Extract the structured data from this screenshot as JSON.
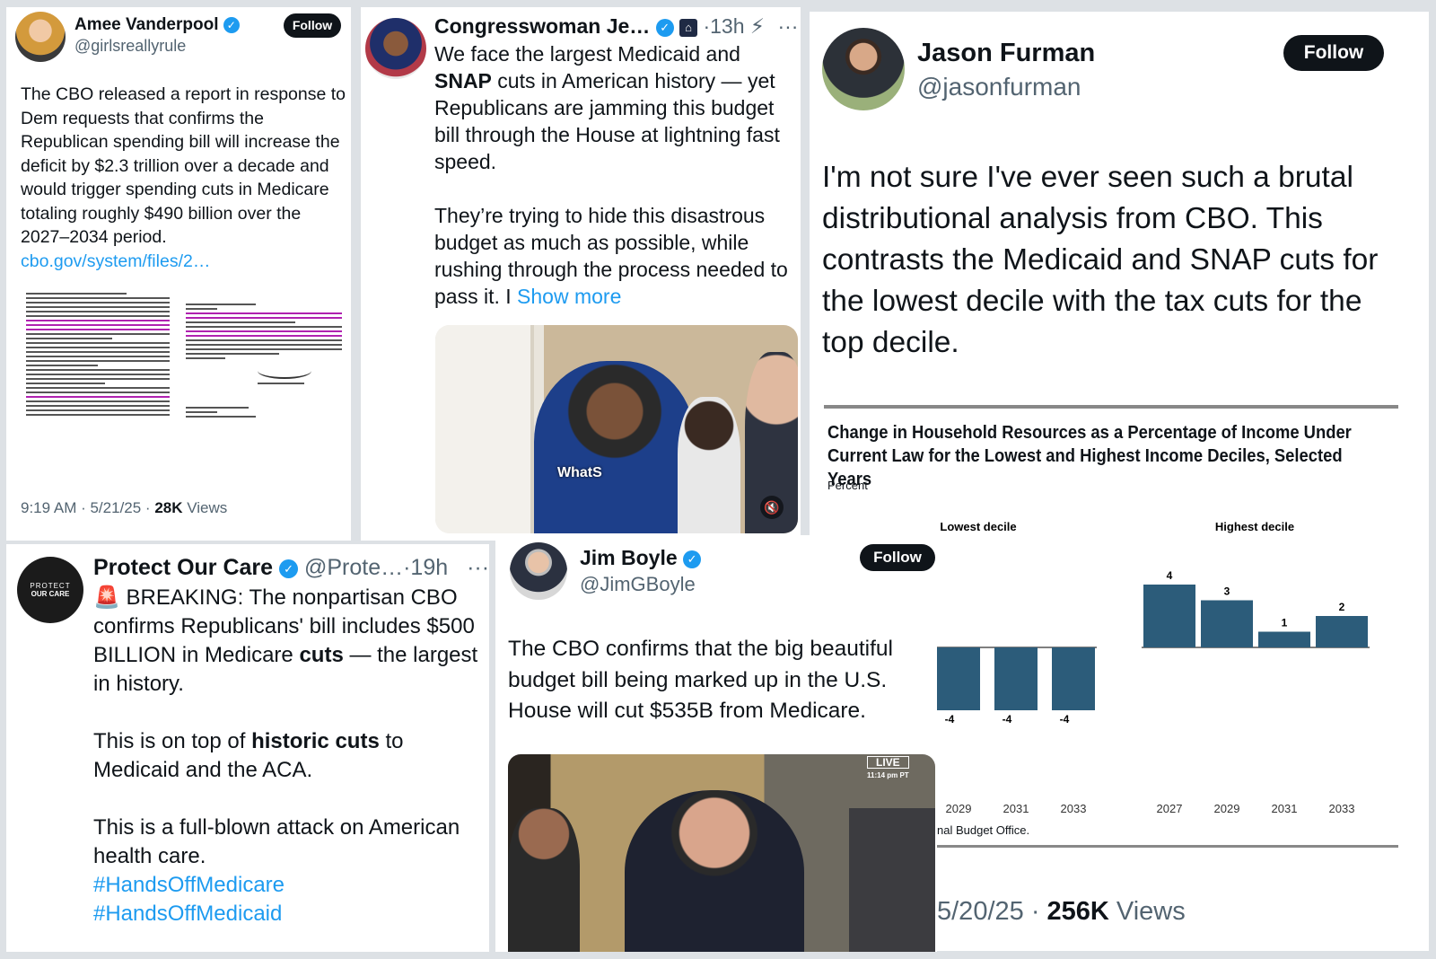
{
  "t1": {
    "name": "Amee Vanderpool",
    "handle": "@girlsreallyrule",
    "follow": "Follow",
    "text": "The CBO released a report in response to Dem requests that confirms the Republican spending bill will increase the deficit by $2.3 trillion over a decade and would trigger spending cuts in Medicare totaling roughly $490 billion over the 2027–2034 period.",
    "link": "cbo.gov/system/files/2…",
    "time": "9:19 AM · 5/21/25 · ",
    "views_count": "28K",
    "views_label": " Views",
    "icons": [
      "verified-badge"
    ]
  },
  "t2": {
    "name": "Congresswoman Je…",
    "time": "·13h",
    "more": "···",
    "text1": "We face the largest Medicaid and",
    "text1b": "SNAP",
    "text1c": " cuts in American history — yet Republicans are jamming this budget bill through the House at lightning fast speed.",
    "text2": "They’re trying to hide this disastrous budget as much as possible, while rushing through the process needed to pass it. I ",
    "show_more": "Show more",
    "caption": "WhatS",
    "icons": [
      "verified-badge",
      "capitol-icon",
      "grok-icon",
      "mute-icon"
    ]
  },
  "t3": {
    "name": "Jason Furman",
    "handle": "@jasonfurman",
    "follow": "Follow",
    "text": "I'm not sure I've ever seen such a brutal distributional analysis from CBO. This contrasts the Medicaid and SNAP cuts for the lowest decile with the tax cuts for the top decile.",
    "time": "5/20/25 · ",
    "views_count": "256K",
    "views_label": " Views",
    "chart": {
      "title": "Change in Household Resources as a Percentage of Income Under Current Law for the Lowest and Highest Income Deciles, Selected Years",
      "unit": "Percent",
      "source": "nal Budget Office.",
      "color": "#2c5c7a"
    }
  },
  "t4": {
    "name": "Protect Our Care",
    "handle": "@Prote…",
    "time": "·19h",
    "more": "···",
    "logo_line1": "PROTECT",
    "logo_line2": "OUR CARE",
    "p1a": "🚨 BREAKING: The nonpartisan CBO confirms Republicans' bill includes $500 BILLION in Medicare ",
    "p1b": "cuts",
    "p1c": " — the largest in history.",
    "p2a": "This is on top of ",
    "p2b": "historic cuts",
    "p2c": " to Medicaid and the ACA.",
    "p3": "This is a full-blown attack on American health care.",
    "tag1": "#HandsOffMedicare",
    "tag2": "#HandsOffMedicaid"
  },
  "t5": {
    "name": "Jim Boyle",
    "handle": "@JimGBoyle",
    "follow": "Follow",
    "text": "The CBO confirms that the big beautiful budget bill being marked up in the U.S. House will cut $535B from Medicare.",
    "live": "LIVE",
    "live_time": "11:14 pm PT"
  },
  "chart_data": [
    {
      "type": "bar",
      "title": "Lowest decile",
      "categories": [
        "2029",
        "2031",
        "2033"
      ],
      "values": [
        -4,
        -4,
        -4
      ]
    },
    {
      "type": "bar",
      "title": "Highest decile",
      "categories": [
        "2027",
        "2029",
        "2031",
        "2033"
      ],
      "values": [
        4,
        3,
        1,
        2
      ]
    }
  ]
}
